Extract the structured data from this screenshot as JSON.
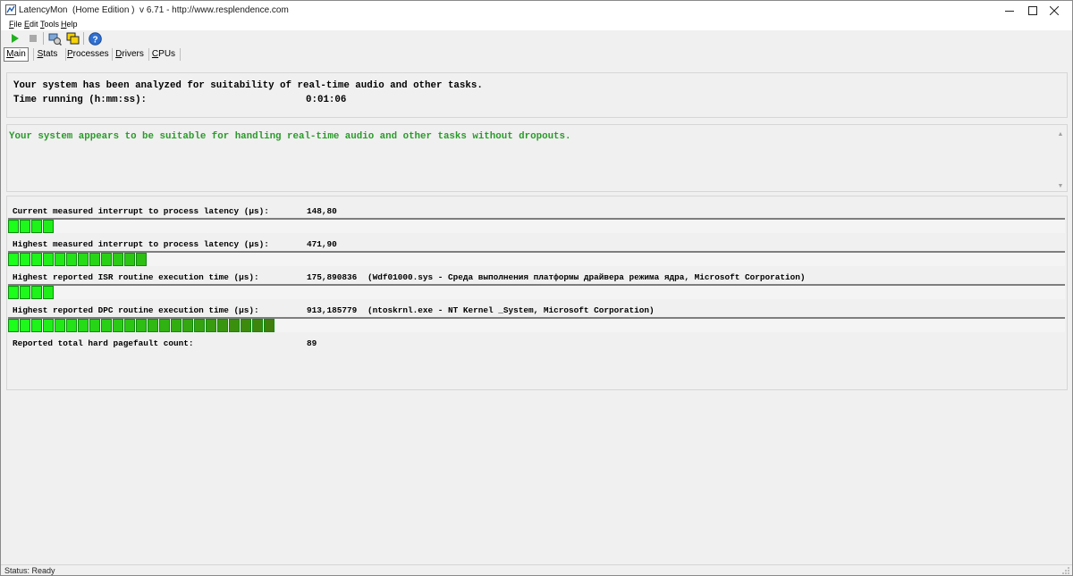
{
  "window": {
    "title": "LatencyMon  (Home Edition )  v 6.71 - http://www.resplendence.com",
    "icons": [
      "app-icon",
      "minimize-icon",
      "maximize-icon",
      "close-icon"
    ]
  },
  "menu": {
    "file": "File",
    "edit": "Edit",
    "tools": "Tools",
    "help": "Help"
  },
  "toolbar": {
    "icons": [
      "play-icon",
      "stop-icon",
      "drivers-icon",
      "processes-icon",
      "help-icon"
    ]
  },
  "tabs": {
    "main": "Main",
    "stats": "Stats",
    "processes": "Processes",
    "drivers": "Drivers",
    "cpus": "CPUs",
    "active": "main"
  },
  "analysis": {
    "headline": "Your system has been analyzed for suitability of real-time audio and other tasks.",
    "time_label": "Time running (h:mm:ss):",
    "time_value": "0:01:06"
  },
  "verdict": {
    "text": "Your system appears to be suitable for handling real-time audio and other tasks without dropouts.",
    "color": "#2a9a2a"
  },
  "metrics": [
    {
      "label": "Current measured interrupt to process latency (µs):",
      "value": "148,80",
      "detail": "",
      "segments": 4
    },
    {
      "label": "Highest measured interrupt to process latency (µs):",
      "value": "471,90",
      "detail": "",
      "segments": 12
    },
    {
      "label": "Highest reported ISR routine execution time (µs):",
      "value": "175,890836",
      "detail": "(Wdf01000.sys - Среда выполнения платформы драйвера режима ядра, Microsoft Corporation)",
      "segments": 4
    },
    {
      "label": "Highest reported DPC routine execution time (µs):",
      "value": "913,185779",
      "detail": "(ntoskrnl.exe - NT Kernel _System, Microsoft Corporation)",
      "segments": 23
    },
    {
      "label": "Reported total hard pagefault count:",
      "value": "89",
      "detail": ""
    }
  ],
  "colors": {
    "bar_bright": "#1bff1b",
    "bar_dark": "#3f7f0b"
  },
  "status": {
    "text": "Status: Ready"
  }
}
